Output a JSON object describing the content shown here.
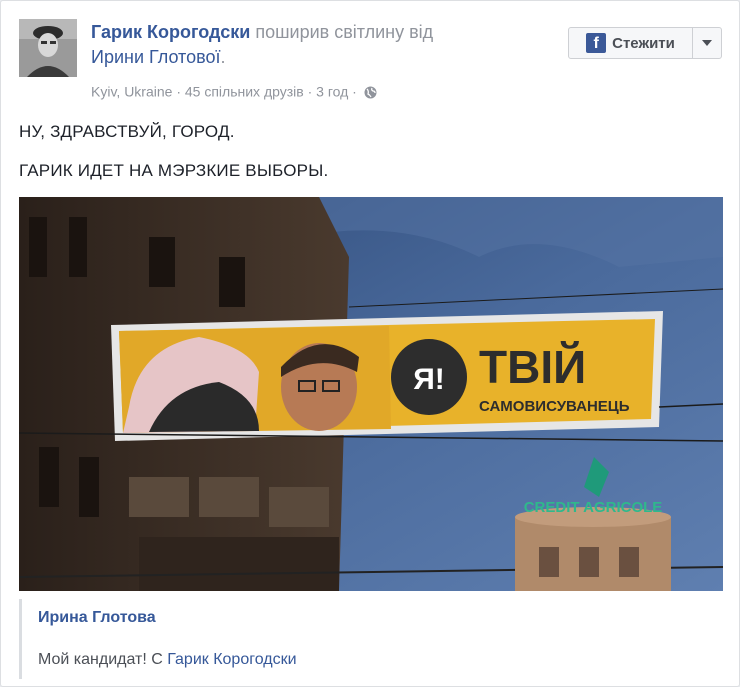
{
  "post": {
    "author": "Гарик Корогодски",
    "shared_text": "поширив світлину від",
    "source_author": "Ирини Глотової",
    "source_suffix": ".",
    "location": "Kyiv, Ukraine",
    "separator": " · ",
    "mutual_friends": "45 спільних друзів",
    "time": "3 год",
    "privacy_icon": "globe-icon",
    "follow_button": "Стежити",
    "fb_icon": "f",
    "line1": "НУ, ЗДРАВСТВУЙ, ГОРОД.",
    "line2": "ГАРИК ИДЕТ НА МЭРЗКИЕ ВЫБОРЫ."
  },
  "photo": {
    "billboard_logo": "Я!",
    "billboard_title": "ТВІЙ",
    "billboard_subtitle": "САМОВИСУВАНЕЦЬ",
    "bank_sign": "CREDIT AGRICOLE"
  },
  "quote": {
    "author": "Ирина Глотова",
    "text": "Мой кандидат! С",
    "mention": "Гарик Корогодски"
  },
  "colors": {
    "link": "#365899",
    "muted": "#90949c",
    "billboard_yellow": "#e8b22a",
    "sky": "#3f5c8c"
  }
}
